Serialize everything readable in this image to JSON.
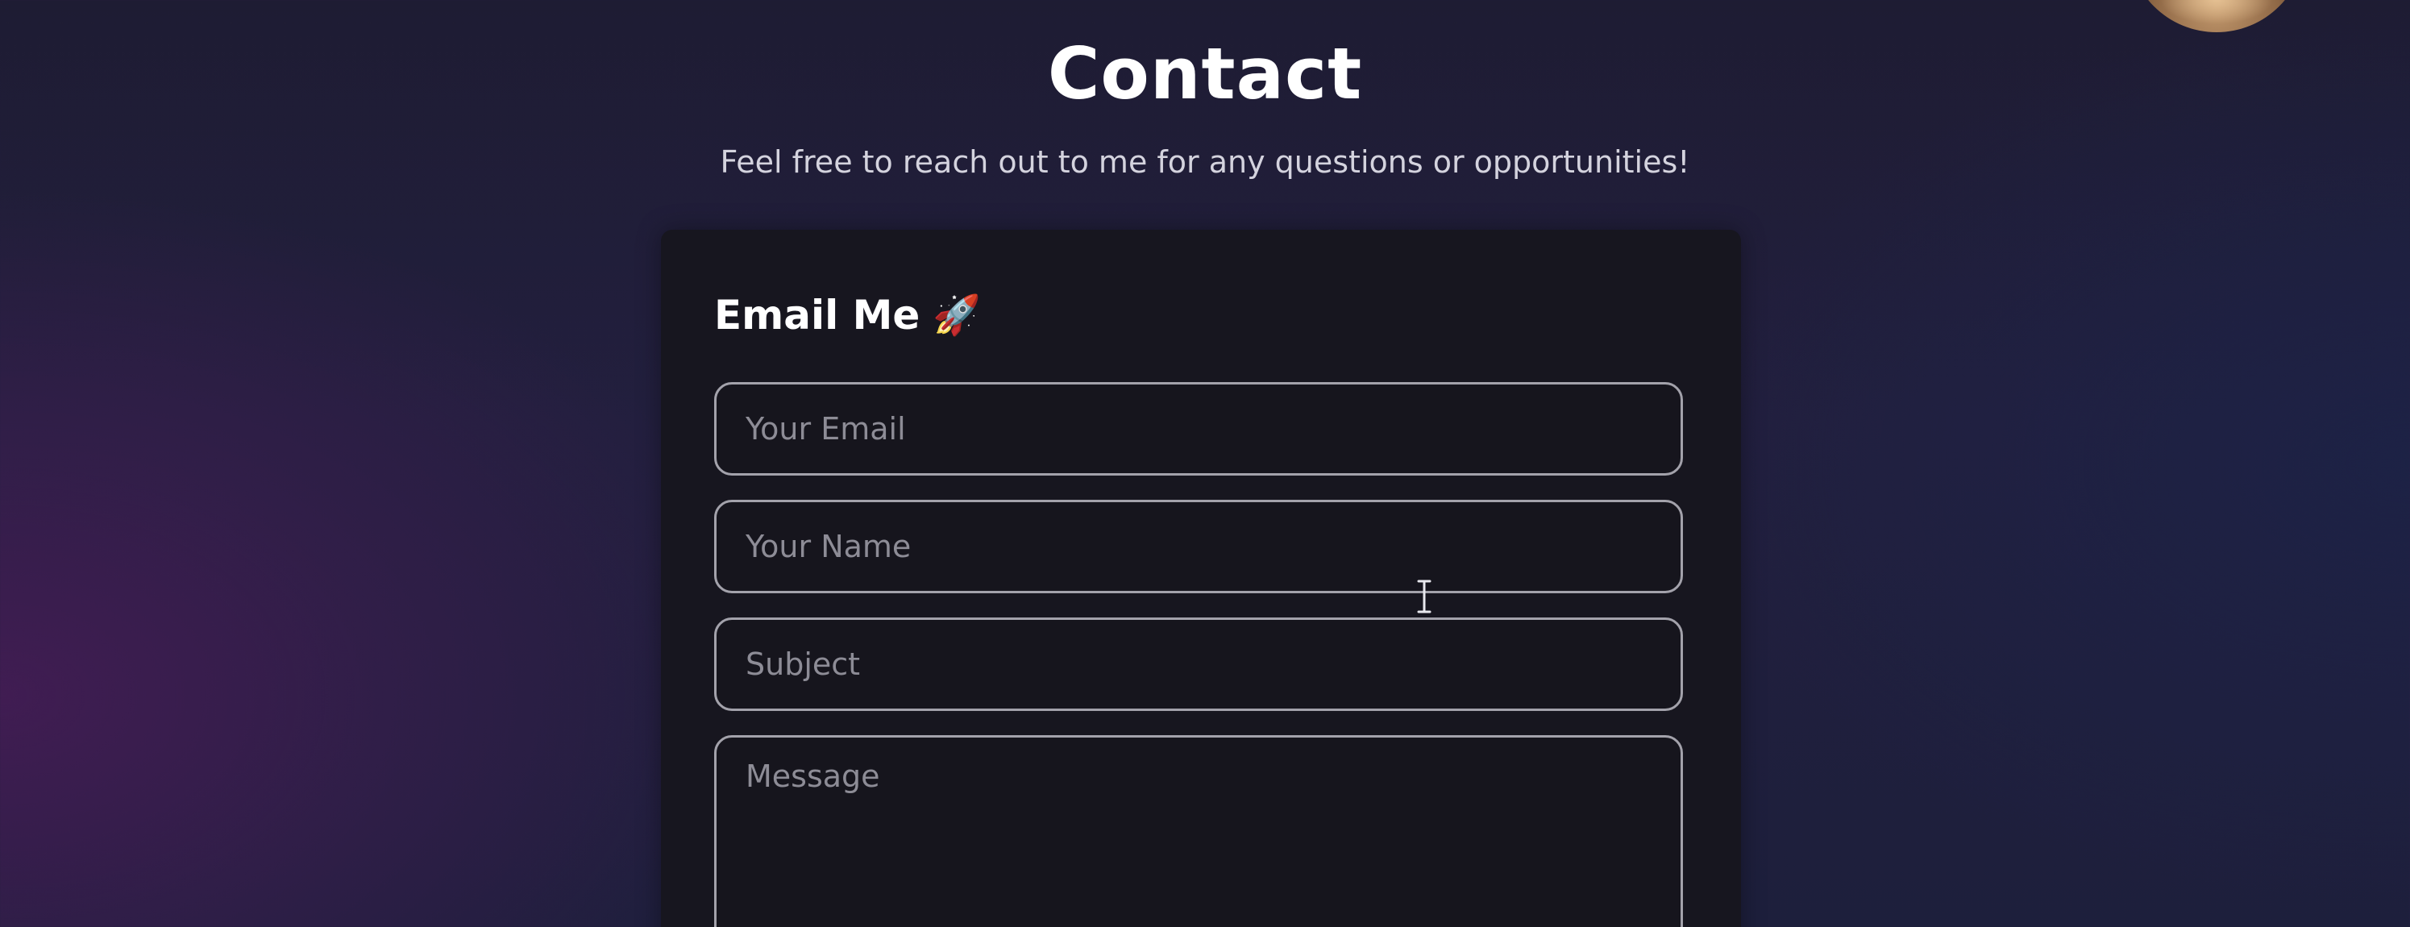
{
  "header": {
    "title": "Contact",
    "subtitle": "Feel free to reach out to me for any questions or opportunities!"
  },
  "form": {
    "heading": "Email Me",
    "heading_icon": "🚀",
    "fields": {
      "email": {
        "placeholder": "Your Email",
        "value": ""
      },
      "name": {
        "placeholder": "Your Name",
        "value": ""
      },
      "subject": {
        "placeholder": "Subject",
        "value": ""
      },
      "message": {
        "placeholder": "Message",
        "value": ""
      }
    }
  },
  "icons": {
    "heading_icon": "rocket-icon",
    "cursor": "text-cursor-icon",
    "avatar": "avatar"
  },
  "colors": {
    "background_left": "#3b1f4f",
    "background_right": "#1d2340",
    "card": "#17161f",
    "field_border": "#a3a2ab",
    "title": "#ffffff",
    "placeholder": "#8d8c96"
  }
}
